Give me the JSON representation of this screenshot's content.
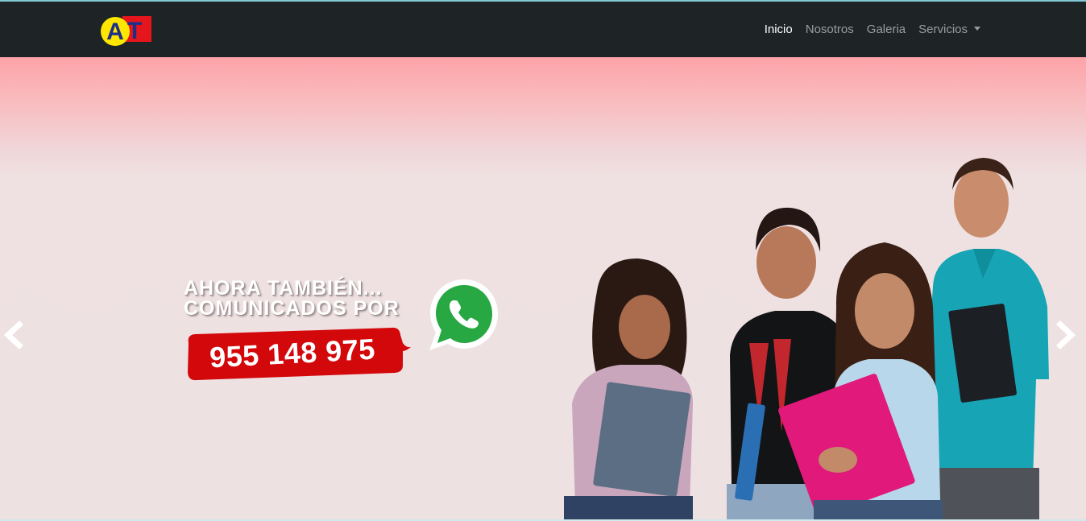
{
  "brand": {
    "logo_text": "AT",
    "colors": {
      "circle": "#ffe600",
      "square": "#e4161c",
      "letter_a": "#1b2f8a",
      "letter_t": "#1b2f8a"
    }
  },
  "nav": {
    "items": [
      {
        "label": "Inicio",
        "active": true
      },
      {
        "label": "Nosotros",
        "active": false
      },
      {
        "label": "Galeria",
        "active": false
      },
      {
        "label": "Servicios",
        "active": false,
        "dropdown": true
      }
    ]
  },
  "hero": {
    "promo_line_1": "AHORA TAMBIÉN...",
    "promo_line_2": "COMUNICADOS POR",
    "phone": "955 148 975",
    "icons": {
      "messaging": "whatsapp-icon",
      "prev": "chevron-left-icon",
      "next": "chevron-right-icon"
    },
    "colors": {
      "badge": "#d3080b",
      "whatsapp": "#27a843",
      "background": "#eee1e2",
      "top_tint": "#fda3a8"
    }
  }
}
